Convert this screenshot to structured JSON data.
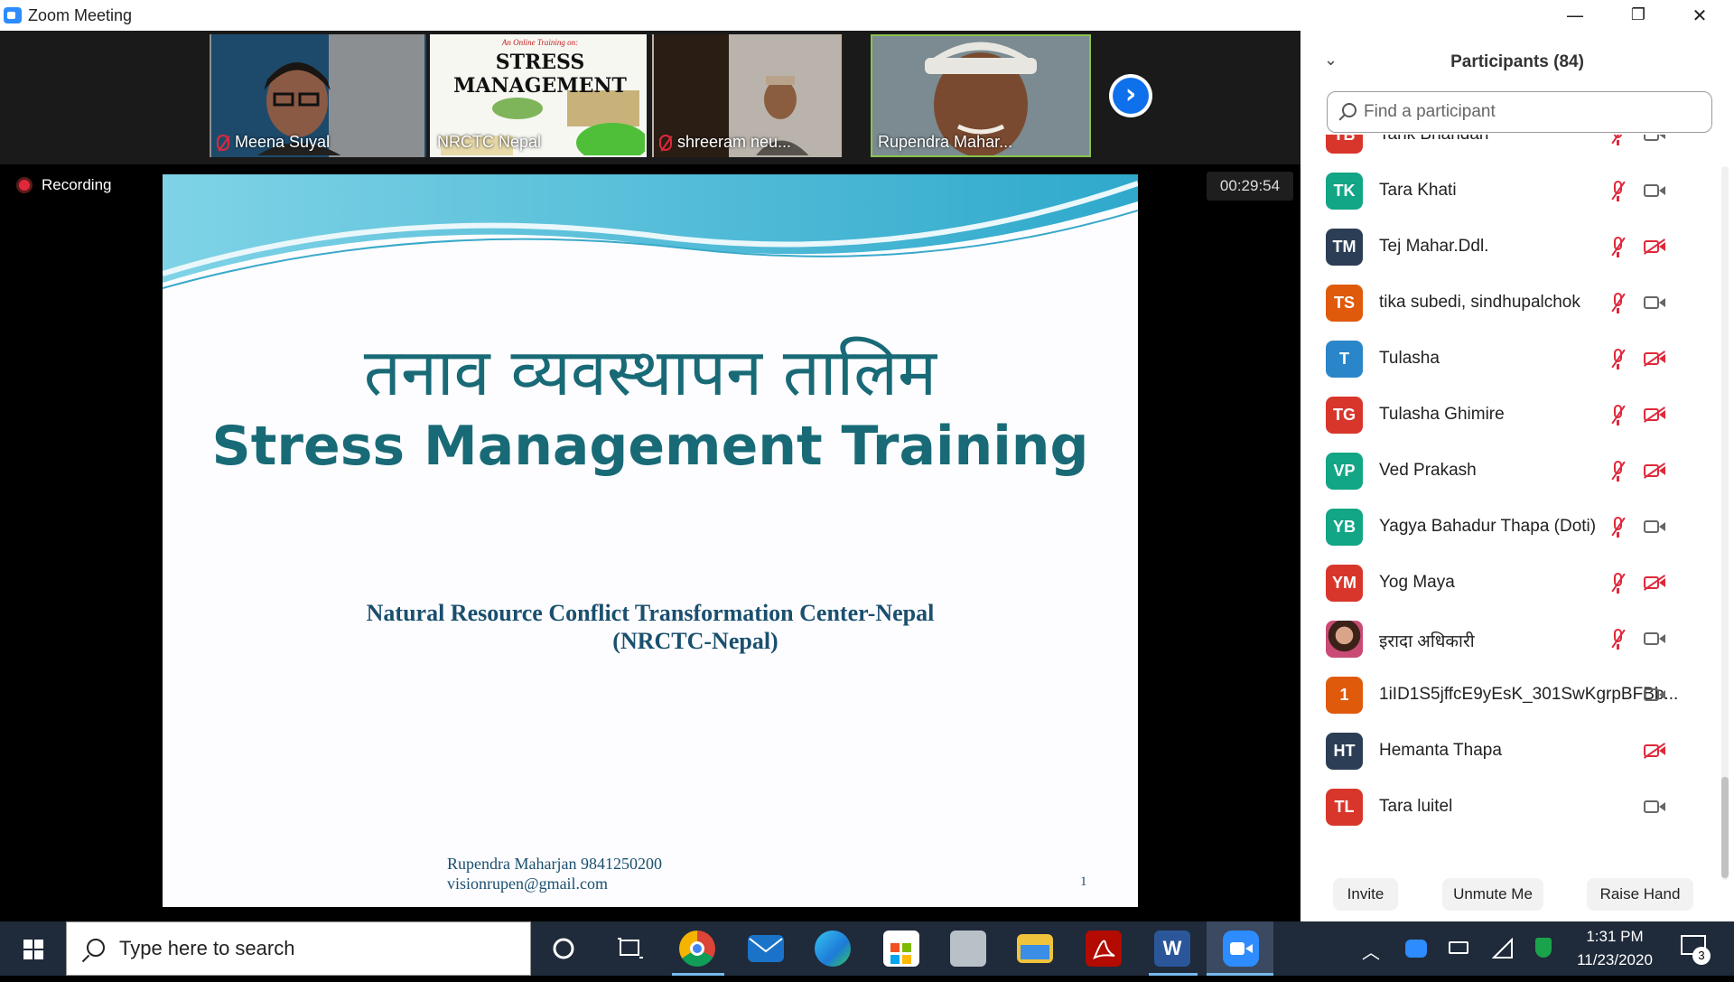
{
  "window": {
    "title": "Zoom Meeting",
    "minimize": "—",
    "restore": "❐",
    "close": "✕"
  },
  "thumbnails": [
    {
      "name": "Meena Suyal",
      "muted": true
    },
    {
      "name": "NRCTC Nepal",
      "muted": false,
      "banner": "An Online Training on:",
      "title": "STRESS MANAGEMENT"
    },
    {
      "name": "shreeram neu...",
      "muted": true
    },
    {
      "name": "Rupendra Mahar...",
      "muted": false,
      "active": true
    }
  ],
  "next_button": "›",
  "recording": {
    "label": "Recording"
  },
  "timer": "00:29:54",
  "slide": {
    "title_hindi": "तनाव व्यवस्थापन तालिम",
    "title_english": "Stress Management Training",
    "org_line1": "Natural Resource Conflict Transformation Center-Nepal",
    "org_line2": "(NRCTC-Nepal)",
    "author_line1": "Rupendra Maharjan 9841250200",
    "author_line2": "visionrupen@gmail.com",
    "page_number": "1"
  },
  "participants_panel": {
    "title": "Participants (84)",
    "search_placeholder": "Find a participant",
    "participants": [
      {
        "initials": "TB",
        "name": "Tank Bhandari",
        "color": "#d9362b",
        "mic": "muted",
        "cam": "on"
      },
      {
        "initials": "TK",
        "name": "Tara Khati",
        "color": "#12a586",
        "mic": "muted",
        "cam": "on"
      },
      {
        "initials": "TM",
        "name": "Tej Mahar.Ddl.",
        "color": "#2c3e55",
        "mic": "muted",
        "cam": "off"
      },
      {
        "initials": "TS",
        "name": "tika subedi, sindhupalchok",
        "color": "#e05a0c",
        "mic": "muted",
        "cam": "on"
      },
      {
        "initials": "T",
        "name": "Tulasha",
        "color": "#2a86c8",
        "mic": "muted",
        "cam": "off"
      },
      {
        "initials": "TG",
        "name": "Tulasha Ghimire",
        "color": "#d9362b",
        "mic": "muted",
        "cam": "off"
      },
      {
        "initials": "VP",
        "name": "Ved Prakash",
        "color": "#12a586",
        "mic": "muted",
        "cam": "off"
      },
      {
        "initials": "YB",
        "name": "Yagya Bahadur Thapa (Doti)",
        "color": "#12a586",
        "mic": "muted",
        "cam": "on"
      },
      {
        "initials": "YM",
        "name": "Yog Maya",
        "color": "#d9362b",
        "mic": "muted",
        "cam": "off"
      },
      {
        "initials": "",
        "name": "इरादा अधिकारी",
        "color": "#c94a74",
        "mic": "muted",
        "cam": "on",
        "photo": true
      },
      {
        "initials": "1",
        "name": "1iID1S5jffcE9yEsK_301SwKgrpBFBb...",
        "color": "#e05a0c",
        "mic": "none",
        "cam": "on"
      },
      {
        "initials": "HT",
        "name": "Hemanta Thapa",
        "color": "#2c3e55",
        "mic": "none",
        "cam": "off"
      },
      {
        "initials": "TL",
        "name": "Tara luitel",
        "color": "#d9362b",
        "mic": "none",
        "cam": "on"
      }
    ],
    "buttons": {
      "invite": "Invite",
      "unmute": "Unmute Me",
      "raise_hand": "Raise Hand"
    }
  },
  "taskbar": {
    "search_placeholder": "Type here to search",
    "time": "1:31 PM",
    "date": "11/23/2020",
    "notification_count": "3"
  }
}
